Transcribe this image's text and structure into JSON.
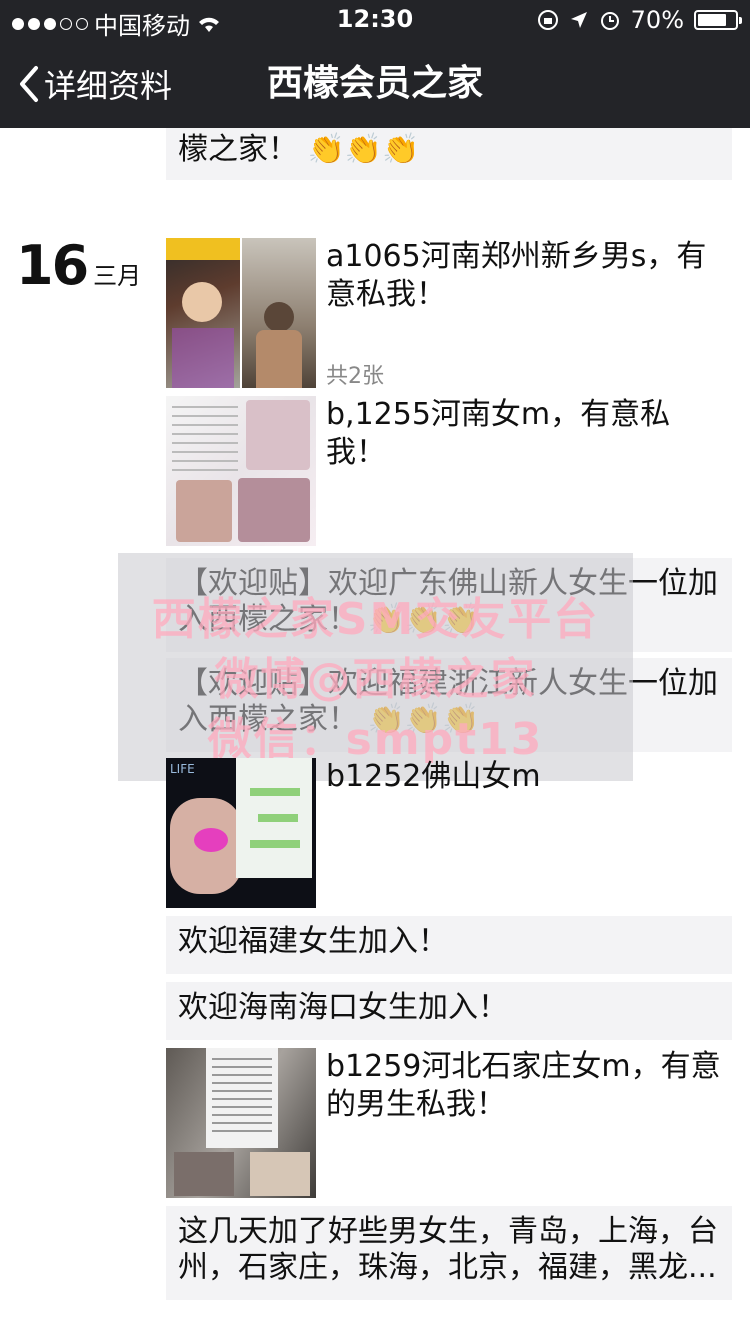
{
  "status": {
    "carrier": "中国移动",
    "time": "12:30",
    "battery": "70%",
    "battery_level": 0.7
  },
  "nav": {
    "back_label": "详细资料",
    "title": "西檬会员之家"
  },
  "date": {
    "day": "16",
    "month": "三月"
  },
  "posts": {
    "top_partial": "檬之家！",
    "p1": {
      "text": "a1065河南郑州新乡男s，有意私我！",
      "count": "共2张"
    },
    "p2": {
      "text": "b,1255河南女m，有意私我！"
    },
    "w1": {
      "text": "【欢迎贴】欢迎广东佛山新人女生一位加入西檬之家！"
    },
    "w2": {
      "text": "【欢迎贴】欢迎福建浙江新人女生一位加入西檬之家！"
    },
    "p3": {
      "text": "b1252佛山女m"
    },
    "t1": {
      "text": "欢迎福建女生加入！"
    },
    "t2": {
      "text": "欢迎海南海口女生加入！"
    },
    "p4": {
      "text": "b1259河北石家庄女m，有意的男生私我！"
    },
    "t3": {
      "text": "这几天加了好些男女生，青岛，上海，台州，石家庄，珠海，北京，福建，黑龙..."
    }
  },
  "watermark": {
    "line1": "西檬之家SM交友平台",
    "line2": "微博@西檬之家",
    "line3": "微信：smpt13"
  },
  "clap_emoji": "👏👏👏"
}
